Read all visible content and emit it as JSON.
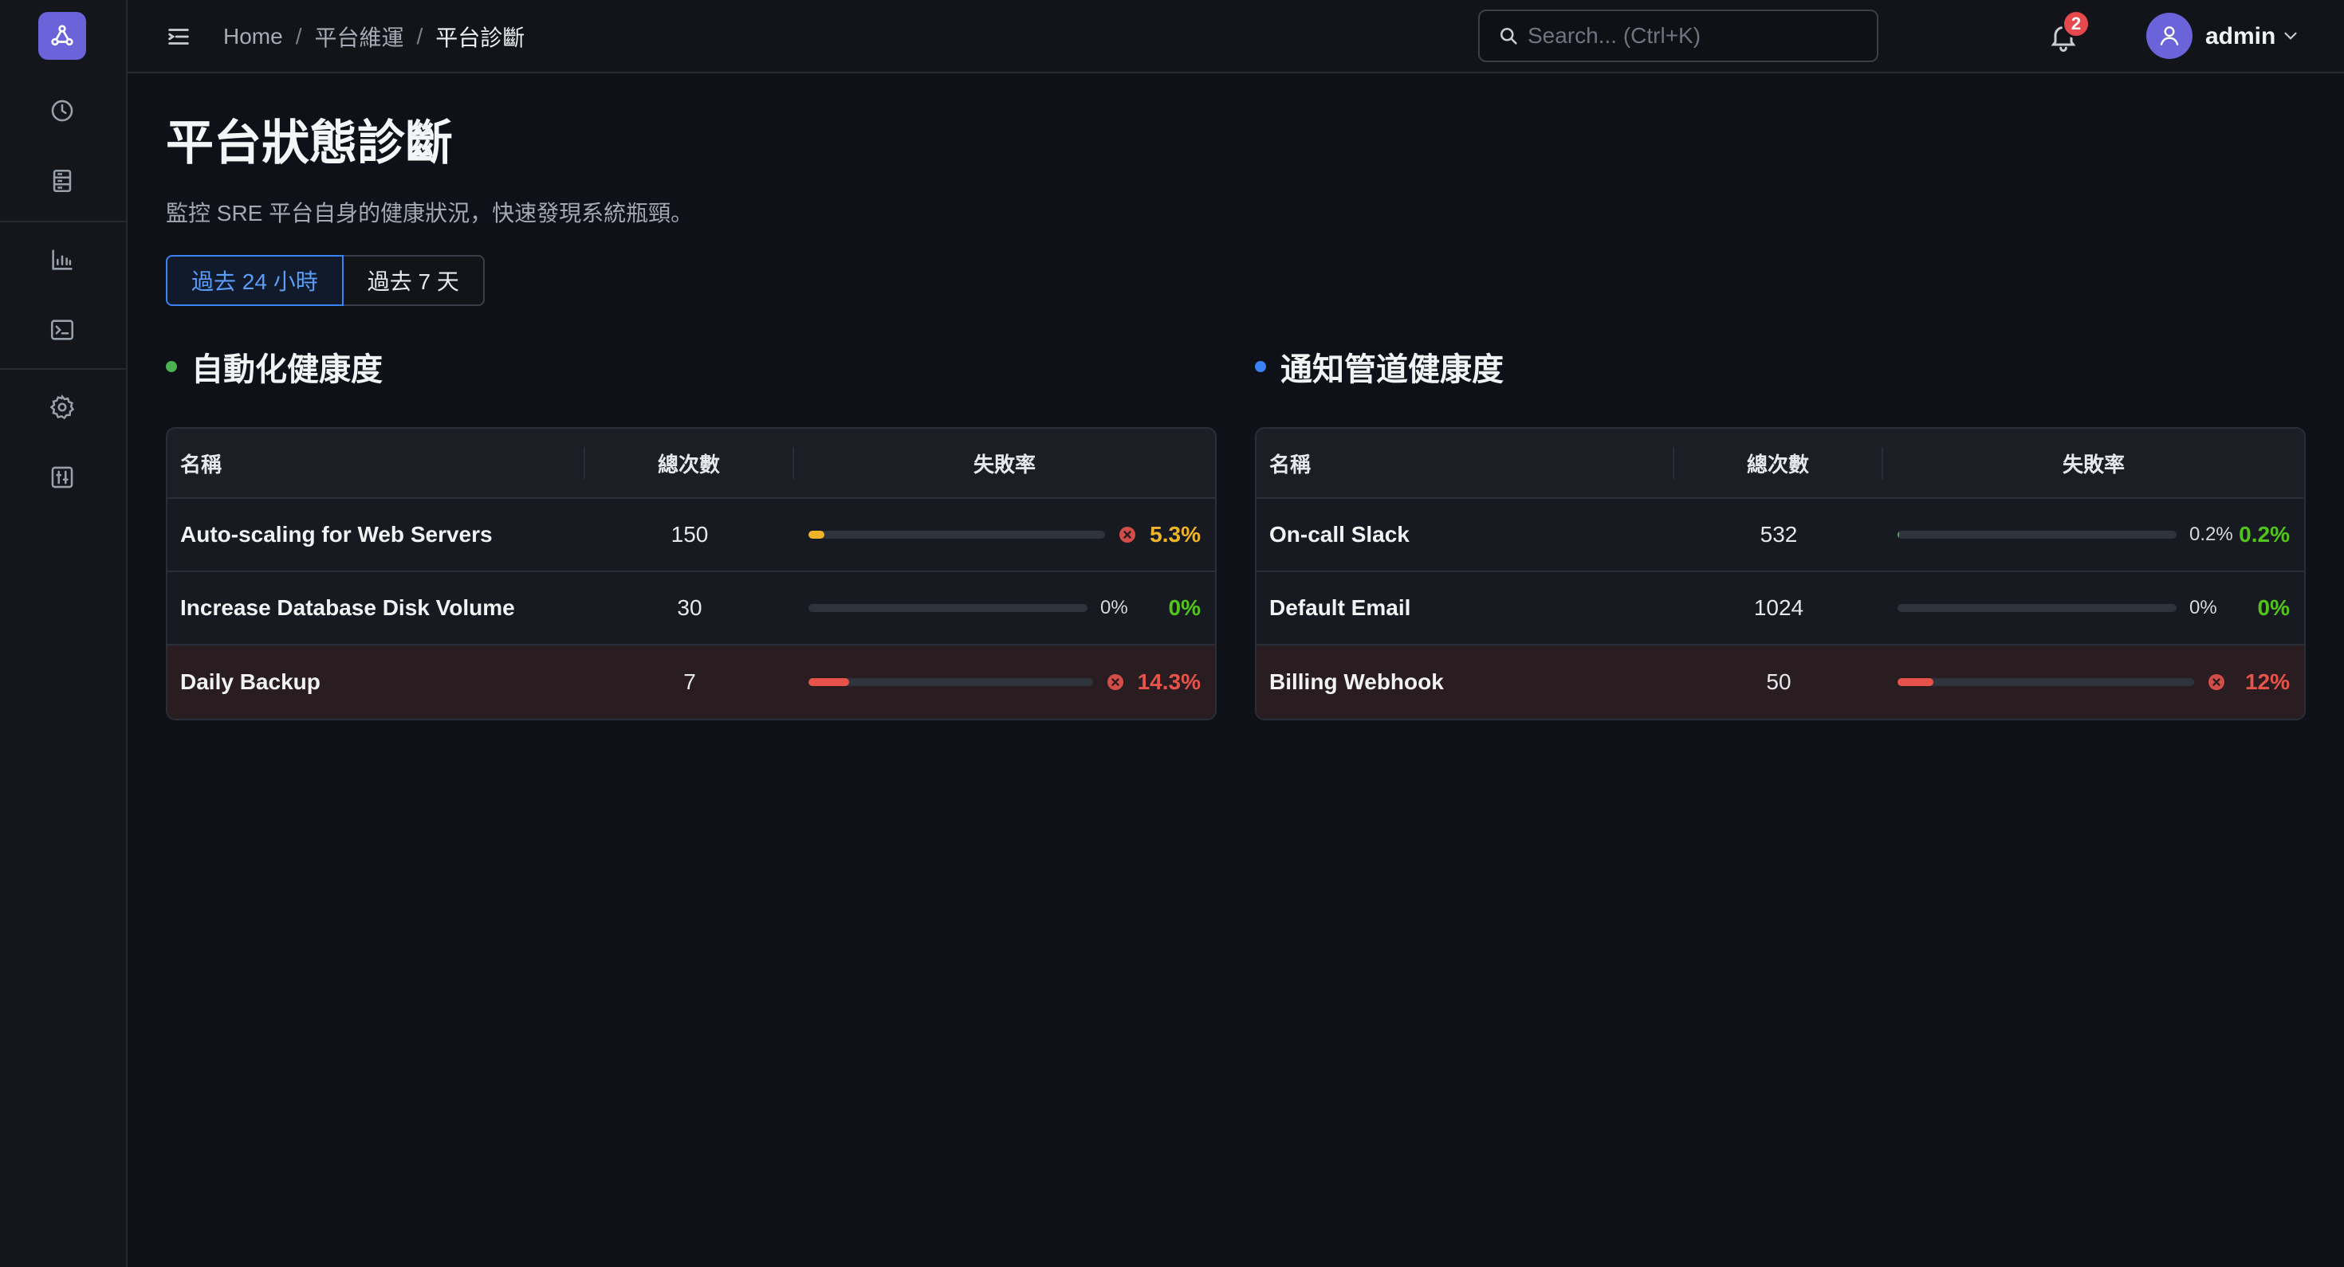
{
  "header": {
    "breadcrumb": [
      "Home",
      "平台維運",
      "平台診斷"
    ],
    "search_placeholder": "Search... (Ctrl+K)",
    "notifications_count": "2",
    "user_name": "admin"
  },
  "page": {
    "title": "平台狀態診斷",
    "description": "監控 SRE 平台自身的健康狀況，快速發現系統瓶頸。",
    "range_tabs": [
      {
        "label": "過去 24 小時",
        "active": true
      },
      {
        "label": "過去 7 天",
        "active": false
      }
    ]
  },
  "panels": {
    "automation": {
      "title": "自動化健康度",
      "dot_color": "#4caf50",
      "columns": {
        "name": "名稱",
        "total": "總次數",
        "rate": "失敗率"
      },
      "rows": [
        {
          "name": "Auto-scaling for Web Servers",
          "total": "150",
          "rate": "5.3%",
          "rate_value": 5.3,
          "status": "warning",
          "bar_color": "#f0b429",
          "rate_color": "#f0b429",
          "show_small_pct": false
        },
        {
          "name": "Increase Database Disk Volume",
          "total": "30",
          "small_pct": "0%",
          "rate": "0%",
          "rate_value": 0,
          "status": "ok",
          "bar_color": "#4caf50",
          "rate_color": "#52c41a",
          "show_small_pct": true
        },
        {
          "name": "Daily Backup",
          "total": "7",
          "rate": "14.3%",
          "rate_value": 14.3,
          "status": "error",
          "bar_color": "#e5534b",
          "rate_color": "#e5534b",
          "show_small_pct": false
        }
      ]
    },
    "notification": {
      "title": "通知管道健康度",
      "dot_color": "#3b82f6",
      "columns": {
        "name": "名稱",
        "total": "總次數",
        "rate": "失敗率"
      },
      "rows": [
        {
          "name": "On-call Slack",
          "total": "532",
          "small_pct": "0.2%",
          "rate": "0.2%",
          "rate_value": 0.2,
          "status": "ok",
          "bar_color": "#4caf50",
          "rate_color": "#52c41a",
          "show_small_pct": true
        },
        {
          "name": "Default Email",
          "total": "1024",
          "small_pct": "0%",
          "rate": "0%",
          "rate_value": 0,
          "status": "ok",
          "bar_color": "#4caf50",
          "rate_color": "#52c41a",
          "show_small_pct": true
        },
        {
          "name": "Billing Webhook",
          "total": "50",
          "rate": "12%",
          "rate_value": 12,
          "status": "error",
          "bar_color": "#e5534b",
          "rate_color": "#e5534b",
          "show_small_pct": false
        }
      ]
    }
  },
  "sidebar": {
    "icons": [
      "logo-icon",
      "history-icon",
      "server-icon",
      "chart-icon",
      "terminal-icon",
      "settings-icon",
      "sliders-icon"
    ]
  }
}
